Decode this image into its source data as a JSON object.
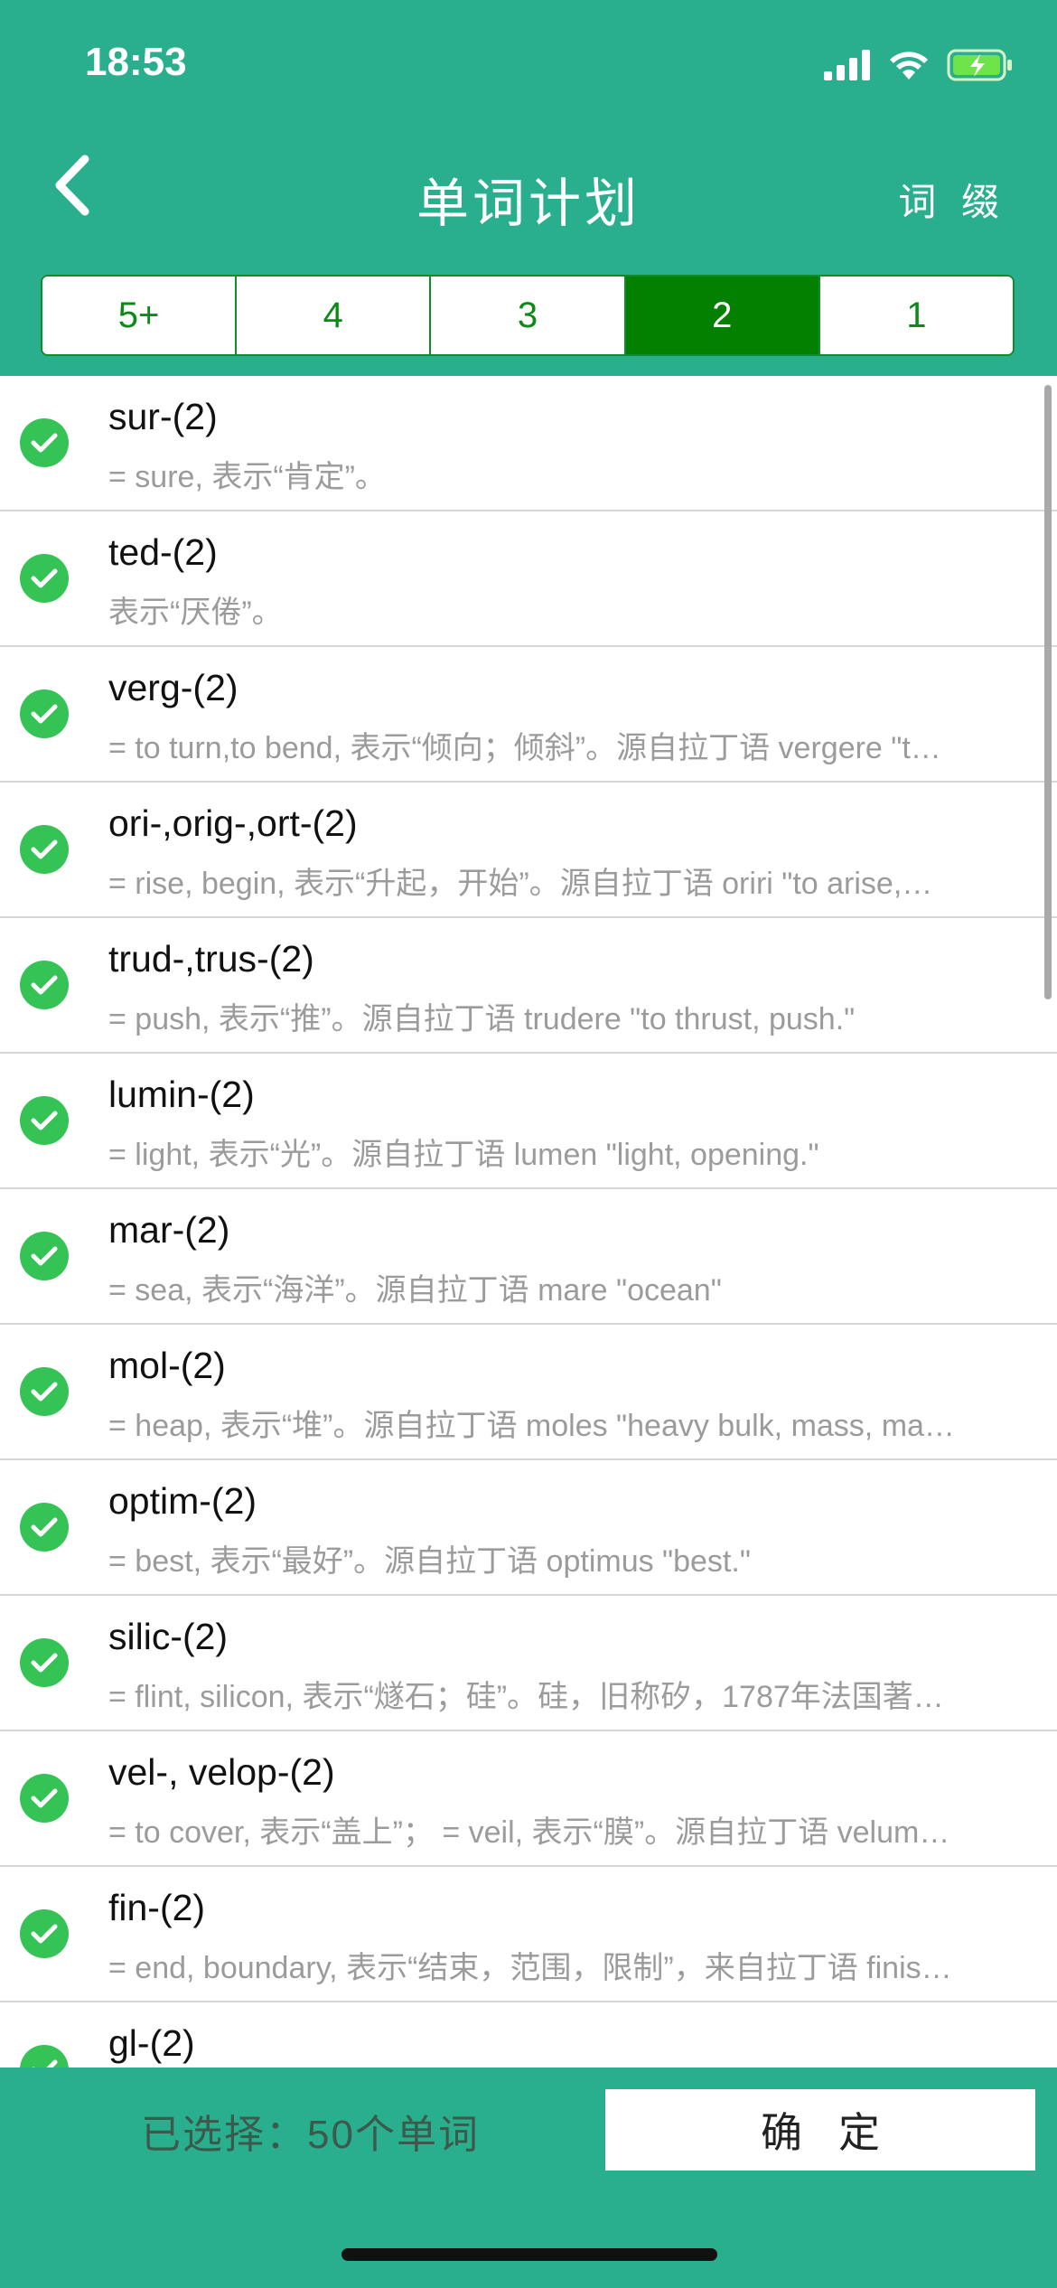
{
  "status_bar": {
    "time": "18:53"
  },
  "nav": {
    "title": "单词计划",
    "right_label": "词 缀"
  },
  "segments": [
    {
      "label": "5+",
      "active": false
    },
    {
      "label": "4",
      "active": false
    },
    {
      "label": "3",
      "active": false
    },
    {
      "label": "2",
      "active": true
    },
    {
      "label": "1",
      "active": false
    }
  ],
  "list": [
    {
      "title": "sur-(2)",
      "desc": "= sure, 表示“肯定”。"
    },
    {
      "title": "ted-(2)",
      "desc": "表示“厌倦”。"
    },
    {
      "title": "verg-(2)",
      "desc": "= to turn,to bend, 表示“倾向；倾斜”。源自拉丁语 vergere \"t…"
    },
    {
      "title": "ori-,orig-,ort-(2)",
      "desc": "= rise, begin, 表示“升起，开始”。源自拉丁语 oriri \"to arise,…"
    },
    {
      "title": "trud-,trus-(2)",
      "desc": "= push, 表示“推”。源自拉丁语 trudere \"to thrust, push.\""
    },
    {
      "title": "lumin-(2)",
      "desc": "= light, 表示“光”。源自拉丁语 lumen \"light, opening.\""
    },
    {
      "title": "mar-(2)",
      "desc": "= sea, 表示“海洋”。源自拉丁语 mare \"ocean\""
    },
    {
      "title": "mol-(2)",
      "desc": "= heap, 表示“堆”。源自拉丁语 moles \"heavy bulk, mass, ma…"
    },
    {
      "title": "optim-(2)",
      "desc": "= best, 表示“最好”。源自拉丁语 optimus \"best.\""
    },
    {
      "title": "silic-(2)",
      "desc": "= flint, silicon, 表示“燧石；硅”。硅，旧称矽，1787年法国著…"
    },
    {
      "title": "vel-, velop-(2)",
      "desc": "= to cover, 表示“盖上”；  = veil, 表示“膜”。源自拉丁语 velum…"
    },
    {
      "title": "fin-(2)",
      "desc": "= end, boundary, 表示“结束，范围，限制”，来自拉丁语 finis…"
    },
    {
      "title": "gl-(2)",
      "desc": ""
    }
  ],
  "footer": {
    "selected_label": "已选择：50个单词",
    "confirm_label": "确定"
  },
  "colors": {
    "header_bg": "#2aaf8e",
    "segment_active": "#038000",
    "check_green": "#35c355"
  }
}
